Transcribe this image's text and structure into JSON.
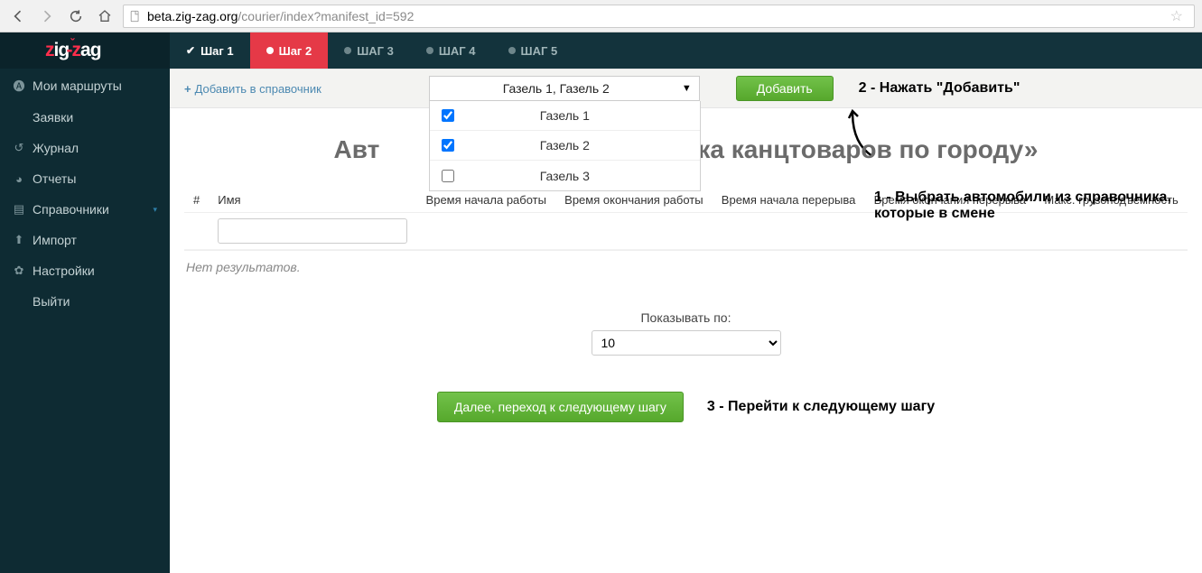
{
  "browser": {
    "url_host": "beta.zig-zag.org",
    "url_path": "/courier/index?manifest_id=592"
  },
  "logo": {
    "part1": "z",
    "part2": "ig",
    "part3": "-",
    "part4": "z",
    "part5": "ag"
  },
  "sidebar": {
    "items": [
      {
        "label": "Мои маршруты",
        "icon": "dashboard-icon"
      },
      {
        "label": "Заявки",
        "icon": ""
      },
      {
        "label": "Журнал",
        "icon": "share-icon"
      },
      {
        "label": "Отчеты",
        "icon": "piechart-icon"
      },
      {
        "label": "Справочники",
        "icon": "list-icon",
        "expand": true
      },
      {
        "label": "Импорт",
        "icon": "upload-icon"
      },
      {
        "label": "Настройки",
        "icon": "gear-icon"
      },
      {
        "label": "Выйти",
        "icon": ""
      }
    ]
  },
  "steps": [
    {
      "label": "Шаг 1",
      "state": "done"
    },
    {
      "label": "Шаг 2",
      "state": "active"
    },
    {
      "label": "ШАГ 3",
      "state": ""
    },
    {
      "label": "ШАГ 4",
      "state": ""
    },
    {
      "label": "ШАГ 5",
      "state": ""
    }
  ],
  "toolbar": {
    "add_dir_label": "Добавить в справочник",
    "dropdown_value": "Газель 1, Газель 2",
    "options": [
      {
        "label": "Газель 1",
        "checked": true
      },
      {
        "label": "Газель 2",
        "checked": true
      },
      {
        "label": "Газель 3",
        "checked": false
      }
    ],
    "add_btn": "Добавить"
  },
  "annotations": {
    "a1": "1 - Выбрать автомобили из справочника, которые в смене",
    "a2": "2 - Нажать \"Добавить\"",
    "a3": "3 - Перейти к следующему шагу"
  },
  "page_title_prefix": "Авт",
  "page_title_suffix": "ставка канцтоваров по городу»",
  "table": {
    "headers": {
      "num": "#",
      "name": "Имя",
      "work_start": "Время начала работы",
      "work_end": "Время окончания работы",
      "break_start": "Время начала перерыва",
      "break_end": "Время окончания перерыва",
      "max_load": "Макс. грузоподъемность"
    },
    "no_results": "Нет результатов."
  },
  "pager": {
    "label": "Показывать по:",
    "value": "10"
  },
  "next_btn": "Далее, переход к следующему шагу"
}
